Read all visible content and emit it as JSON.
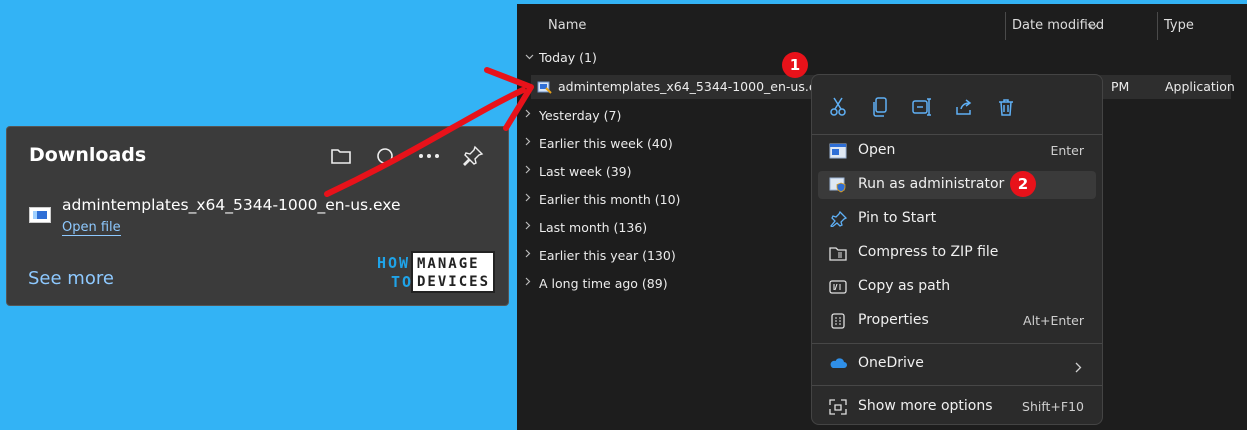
{
  "downloads": {
    "title": "Downloads",
    "file_name": "admintemplates_x64_5344-1000_en-us.exe",
    "open_file": "Open file",
    "see_more": "See more",
    "logo": {
      "how": "HOW",
      "to": "TO",
      "manage": "MANAGE",
      "devices": "DEVICES"
    }
  },
  "explorer": {
    "columns": {
      "name": "Name",
      "date_modified": "Date modified",
      "type": "Type"
    },
    "groups": {
      "today": "Today (1)",
      "yesterday": "Yesterday (7)",
      "earlier_week": "Earlier this week (40)",
      "last_week": "Last week (39)",
      "earlier_month": "Earlier this month (10)",
      "last_month": "Last month (136)",
      "earlier_year": "Earlier this year (130)",
      "long_ago": "A long time ago (89)"
    },
    "file": {
      "name": "admintemplates_x64_5344-1000_en-us.exe",
      "date_fragment": "PM",
      "type": "Application"
    }
  },
  "badges": {
    "one": "1",
    "two": "2"
  },
  "context_menu": {
    "open": {
      "label": "Open",
      "shortcut": "Enter"
    },
    "run_admin": {
      "label": "Run as administrator"
    },
    "pin_start": {
      "label": "Pin to Start"
    },
    "compress": {
      "label": "Compress to ZIP file"
    },
    "copy_path": {
      "label": "Copy as path"
    },
    "properties": {
      "label": "Properties",
      "shortcut": "Alt+Enter"
    },
    "onedrive": {
      "label": "OneDrive"
    },
    "more_options": {
      "label": "Show more options",
      "shortcut": "Shift+F10"
    }
  },
  "colors": {
    "background": "#33b3f5",
    "badge": "#e8121a",
    "arrow": "#e8121a",
    "link": "#8ec9ff"
  }
}
